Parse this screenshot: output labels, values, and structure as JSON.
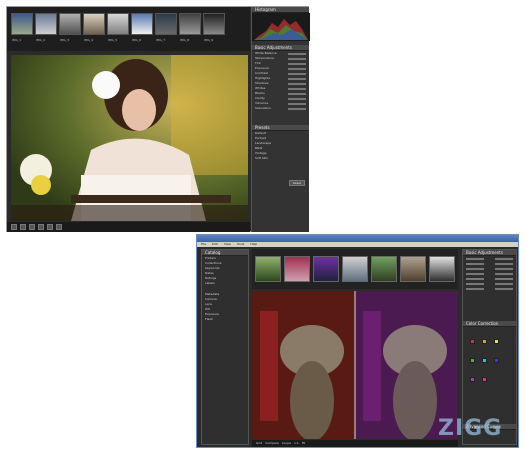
{
  "shot1": {
    "panels": {
      "histogram_header": "Histogram",
      "basic_header": "Basic Adjustments",
      "presets_header": "Presets"
    },
    "thumbnails": [
      "IMG_1",
      "IMG_2",
      "IMG_3",
      "IMG_4",
      "IMG_5",
      "IMG_6",
      "IMG_7",
      "IMG_8",
      "IMG_9"
    ],
    "basic_rows": [
      "White Balance",
      "Temperature",
      "Tint",
      "Exposure",
      "Contrast",
      "Highlights",
      "Shadows",
      "Whites",
      "Blacks",
      "Clarity",
      "Vibrance",
      "Saturation"
    ],
    "preset_rows": [
      "Default",
      "Portrait",
      "Landscape",
      "B&W",
      "Vintage",
      "Soft Skin"
    ],
    "panel_button": "Reset"
  },
  "shot2": {
    "menu": [
      "File",
      "Edit",
      "View",
      "Tools",
      "Help"
    ],
    "left_header": "Catalog",
    "left_items": [
      "Folders",
      "Collections",
      "Keywords",
      "Dates",
      "Ratings",
      "Labels",
      "Metadata",
      "Camera",
      "Lens",
      "ISO",
      "Exposure",
      "Flash"
    ],
    "right_header": "Basic Adjustments",
    "right_header2": "Color Correction",
    "right_header3": "Advanced Curves",
    "status_items": [
      "Grid",
      "Compare",
      "Loupe",
      "1:1",
      "Fit"
    ]
  },
  "watermark": "ZIGG",
  "colors": {
    "accent_blue": "#3b63a6",
    "panel_dark": "#2f2f2f"
  }
}
